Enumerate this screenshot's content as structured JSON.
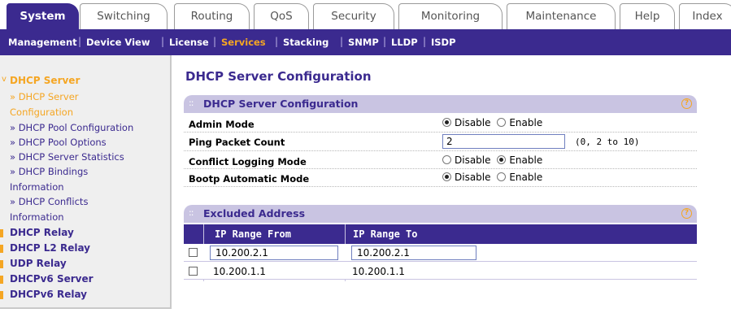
{
  "tabs": [
    "System",
    "Switching",
    "Routing",
    "QoS",
    "Security",
    "Monitoring",
    "Maintenance",
    "Help",
    "Index"
  ],
  "subnav": [
    "Management",
    "Device View",
    "License",
    "Services",
    "Stacking",
    "SNMP",
    "LLDP",
    "ISDP"
  ],
  "leftnav": {
    "dhcp_server": "DHCP Server",
    "dhcp_server_config_1": "» DHCP Server",
    "dhcp_server_config_2": "Configuration",
    "pool_config": "» DHCP Pool Configuration",
    "pool_options": "» DHCP Pool Options",
    "server_stats": "» DHCP Server Statistics",
    "bindings_1": "» DHCP Bindings",
    "bindings_2": "Information",
    "conflicts_1": "» DHCP Conflicts",
    "conflicts_2": "Information",
    "relay": "DHCP Relay",
    "l2relay": "DHCP L2 Relay",
    "udp": "UDP Relay",
    "v6server": "DHCPv6 Server",
    "v6relay": "DHCPv6 Relay"
  },
  "page_title": "DHCP Server Configuration",
  "config_panel": {
    "title": "DHCP Server Configuration",
    "admin_mode": "Admin Mode",
    "ping_count": "Ping Packet Count",
    "ping_value": "2",
    "ping_hint": "(0, 2 to 10)",
    "conflict_logging": "Conflict Logging Mode",
    "bootp_mode": "Bootp Automatic Mode",
    "disable": "Disable",
    "enable": "Enable"
  },
  "excluded_panel": {
    "title": "Excluded Address",
    "col_from": "IP Range From",
    "col_to": "IP Range To",
    "new_from": "10.200.2.1",
    "new_to": "10.200.2.1",
    "row1_from": "10.200.1.1",
    "row1_to": "10.200.1.1"
  },
  "help_symbol": "?",
  "colors": {
    "brand": "#3b2a8f",
    "accent": "#f5a623",
    "panel": "#c9c4e2"
  }
}
